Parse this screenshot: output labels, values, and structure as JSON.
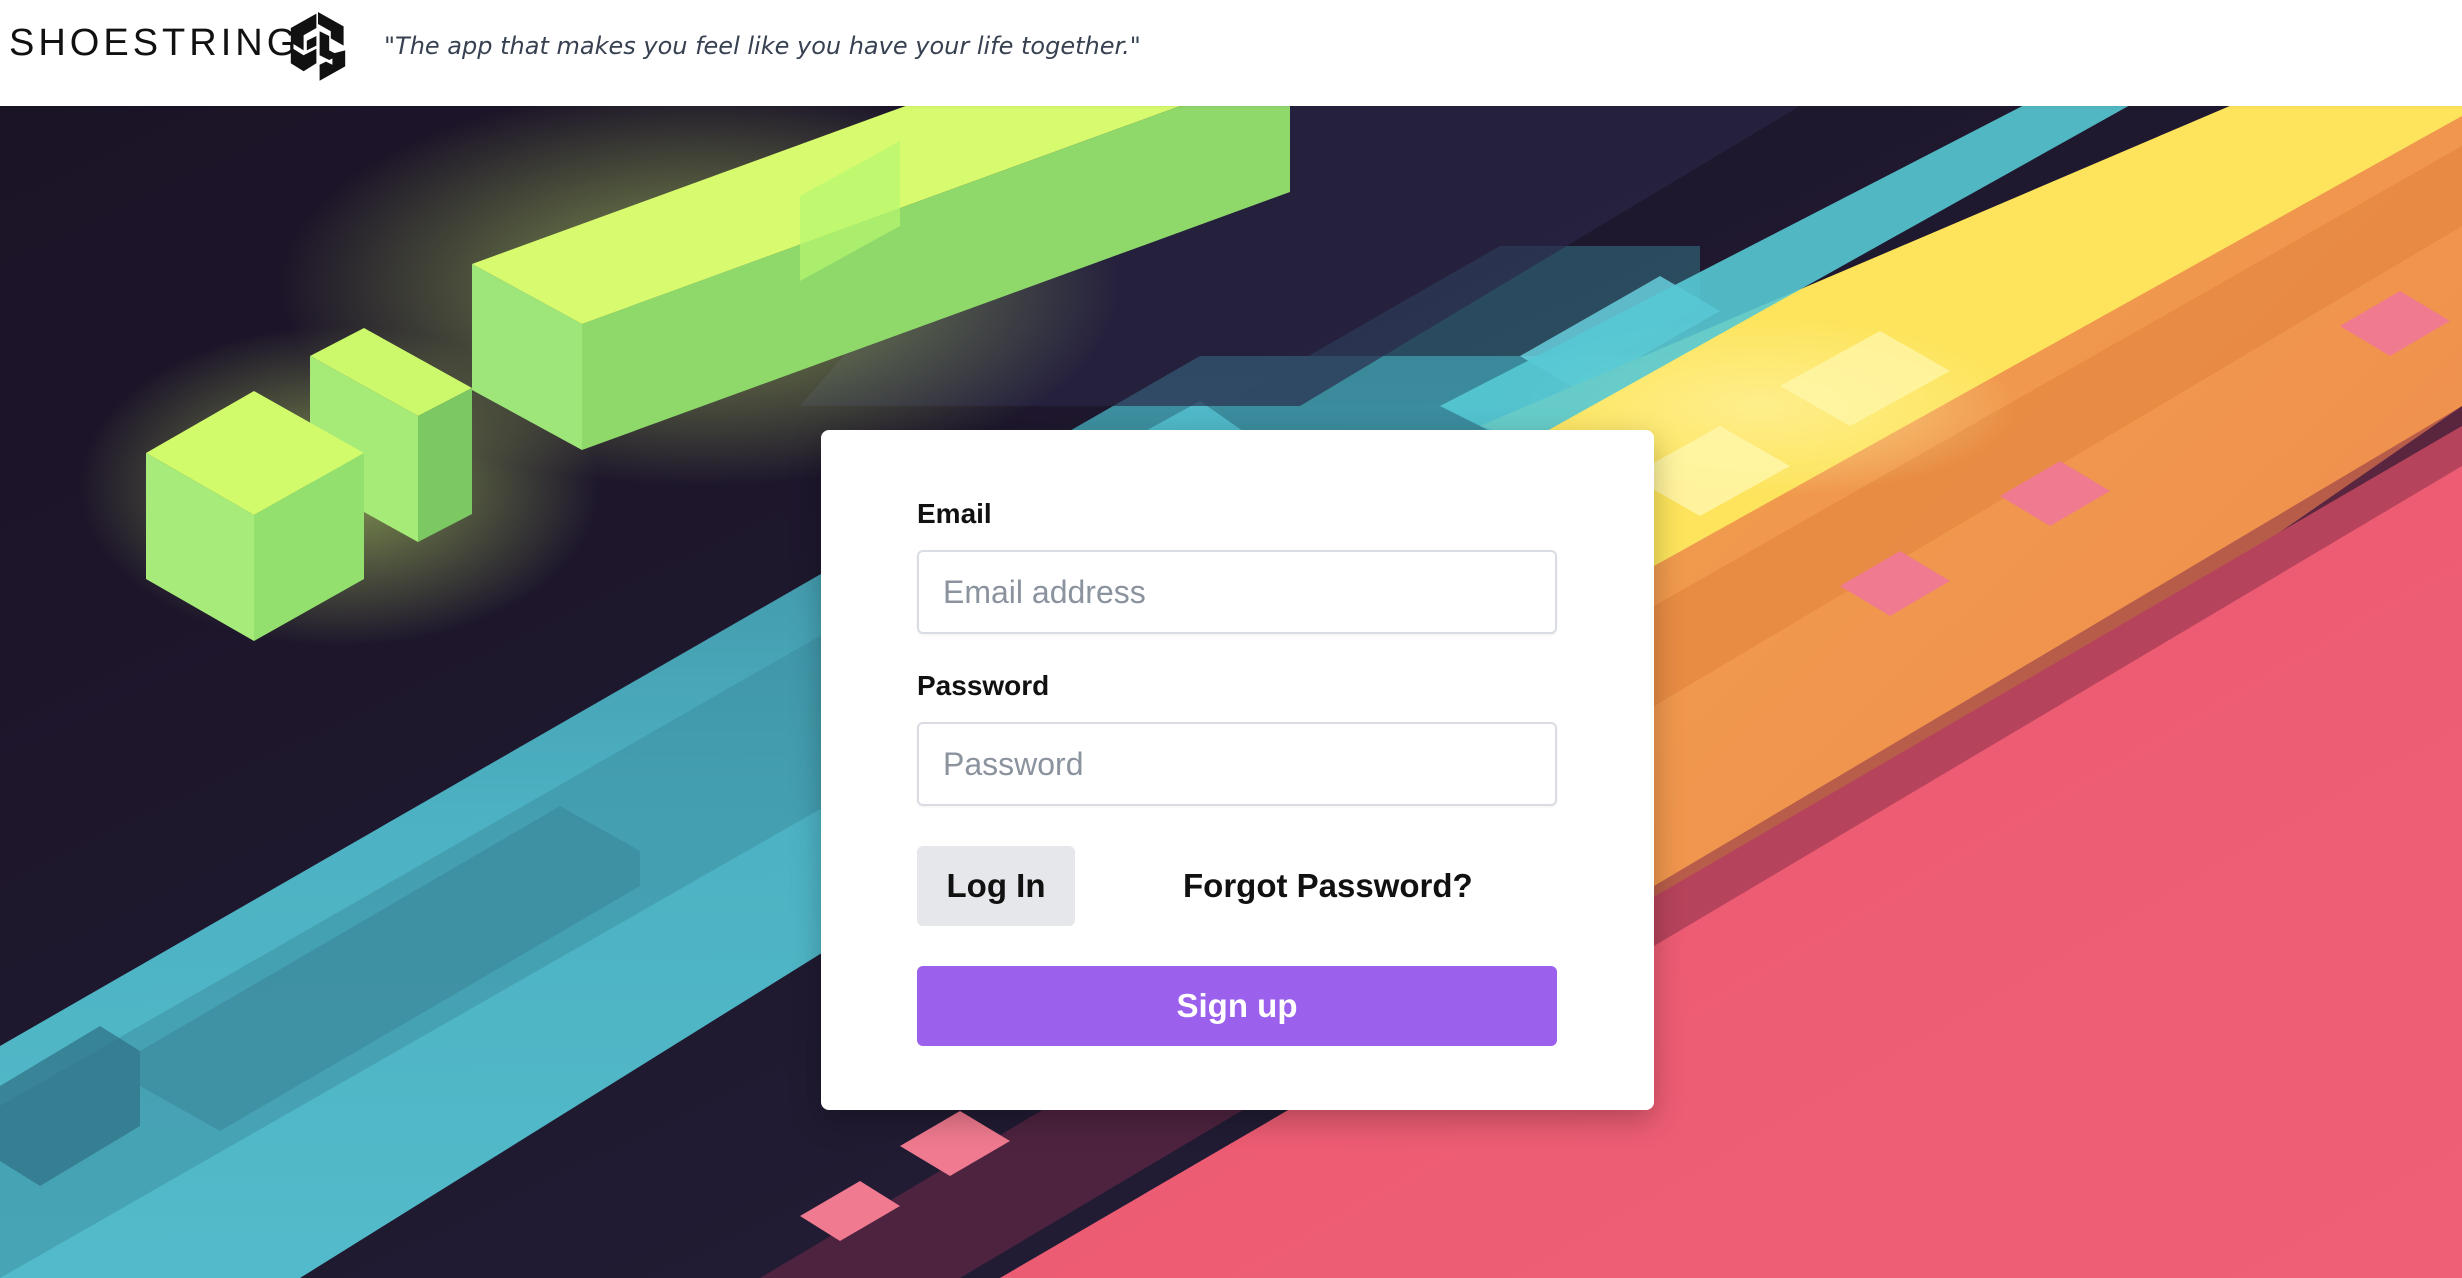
{
  "header": {
    "brand_name": "SHOESTRING",
    "logo_icon": "interlocking-shoelace-knot-icon",
    "tagline": "\"The app that makes you feel like you have your life together.\""
  },
  "login_form": {
    "email_label": "Email",
    "email_placeholder": "Email address",
    "email_value": "",
    "password_label": "Password",
    "password_placeholder": "Password",
    "password_value": "",
    "login_label": "Log In",
    "forgot_label": "Forgot Password?",
    "signup_label": "Sign up"
  },
  "colors": {
    "brand_text": "#111111",
    "signup_button": "#9b61ec",
    "login_button": "#e5e7eb",
    "background_dark": "#1c1428",
    "background_green": "#b8f56a",
    "background_teal": "#52c0cf",
    "background_yellow": "#fde45c",
    "background_orange": "#f0964c",
    "background_pink": "#ec5d74"
  }
}
